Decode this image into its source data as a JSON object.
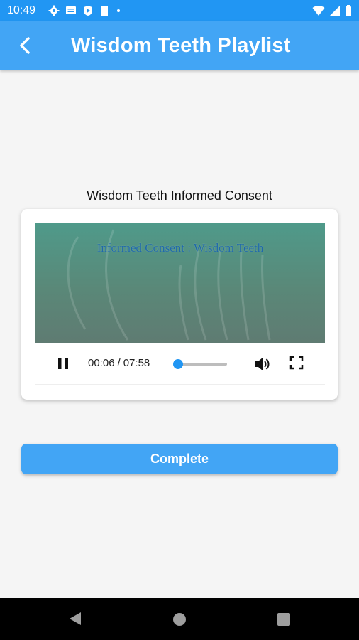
{
  "status_bar": {
    "time": "10:49",
    "left_icons": [
      "gear-icon",
      "message-icon",
      "play-shield-icon",
      "sd-card-icon",
      "dot-icon"
    ],
    "right_icons": [
      "wifi-icon",
      "cell-signal-icon",
      "battery-icon"
    ]
  },
  "app_bar": {
    "title": "Wisdom Teeth Playlist",
    "back_icon": "chevron-left-icon"
  },
  "video_card": {
    "title": "Wisdom Teeth Informed Consent",
    "overlay_text": "Informed Consent : Wisdom Teeth",
    "current_time": "00:06",
    "separator": "/",
    "total_time": "07:58",
    "progress_fraction": 0.013
  },
  "actions": {
    "complete_label": "Complete"
  },
  "colors": {
    "status_bar": "#2196f3",
    "app_bar": "#42a5f5",
    "accent": "#2196f3",
    "background": "#f5f5f5"
  },
  "nav_bar": {
    "icons": [
      "back-triangle-icon",
      "home-circle-icon",
      "recents-square-icon"
    ]
  }
}
